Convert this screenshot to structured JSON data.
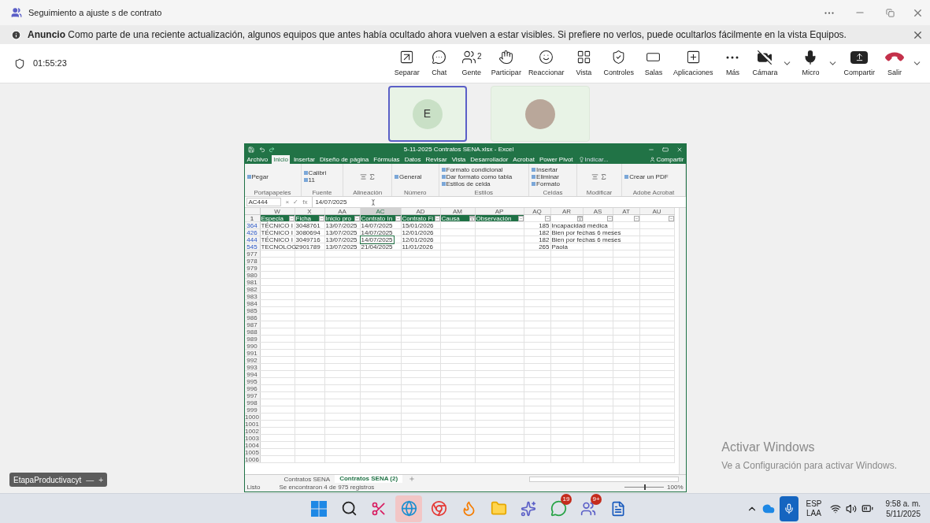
{
  "window": {
    "title": "Seguimiento a ajuste s de contrato"
  },
  "announcement": {
    "label": "Anuncio",
    "text": "Como parte de una reciente actualización, algunos equipos que antes había ocultado ahora vuelven a estar visibles. Si prefiere no verlos, puede ocultarlos fácilmente en la vista Equipos."
  },
  "meeting": {
    "timer": "01:55:23"
  },
  "toolbar": [
    {
      "kind": "popout",
      "label": "Separar"
    },
    {
      "kind": "chat",
      "label": "Chat"
    },
    {
      "kind": "people",
      "label": "Gente",
      "badge": "2"
    },
    {
      "kind": "hand",
      "label": "Participar"
    },
    {
      "kind": "react",
      "label": "Reaccionar"
    },
    {
      "kind": "view",
      "label": "Vista"
    },
    {
      "kind": "controls",
      "label": "Controles"
    },
    {
      "kind": "rooms",
      "label": "Salas"
    },
    {
      "kind": "apps",
      "label": "Aplicaciones"
    },
    {
      "kind": "more",
      "label": "Más"
    },
    {
      "kind": "camera",
      "label": "Cámara",
      "on": false,
      "dropdown": true
    },
    {
      "kind": "mic",
      "label": "Micro",
      "on": true,
      "dropdown": true
    },
    {
      "kind": "share",
      "label": "Compartir"
    },
    {
      "kind": "leave",
      "label": "Salir",
      "dropdown": true
    }
  ],
  "participants": [
    {
      "kind": "initial",
      "initial": "E",
      "speaking": true
    },
    {
      "kind": "photo",
      "speaking": false
    }
  ],
  "excel": {
    "title": "5-11-2025 Contratos SENA.xlsx - Excel",
    "tabs": [
      {
        "label": "Archivo",
        "selected": false
      },
      {
        "label": "Inicio",
        "selected": true
      },
      {
        "label": "Insertar",
        "selected": false
      },
      {
        "label": "Diseño de página",
        "selected": false
      },
      {
        "label": "Fórmulas",
        "selected": false
      },
      {
        "label": "Datos",
        "selected": false
      },
      {
        "label": "Revisar",
        "selected": false
      },
      {
        "label": "Vista",
        "selected": false
      },
      {
        "label": "Desarrollador",
        "selected": false
      },
      {
        "label": "Acrobat",
        "selected": false
      },
      {
        "label": "Power Pivot",
        "selected": false
      }
    ],
    "tell_me": "Indicar...",
    "share": "Compartir",
    "ribbon": [
      {
        "name": "Portapapeles",
        "items": [
          "Pegar"
        ]
      },
      {
        "name": "Fuente",
        "items": [
          "Calibri",
          "11"
        ]
      },
      {
        "name": "Alineación"
      },
      {
        "name": "Número",
        "items": [
          "General"
        ]
      },
      {
        "name": "Estilos",
        "items": [
          "Formato condicional",
          "Dar formato como tabla",
          "Estilos de celda"
        ]
      },
      {
        "name": "Celdas",
        "items": [
          "Insertar",
          "Eliminar",
          "Formato"
        ]
      },
      {
        "name": "Modificar"
      },
      {
        "name": "Adobe Acrobat",
        "items": [
          "Crear un PDF"
        ]
      }
    ],
    "name_box": "AC444",
    "formula_buttons": [
      "×",
      "✓",
      "fx"
    ],
    "formula": "14/07/2025",
    "columns": [
      {
        "label": "W",
        "selected": false
      },
      {
        "label": "X",
        "selected": false
      },
      {
        "label": "AA",
        "selected": false
      },
      {
        "label": "AC",
        "selected": true
      },
      {
        "label": "AD",
        "selected": false
      },
      {
        "label": "AM",
        "selected": false
      },
      {
        "label": "AP",
        "selected": false
      },
      {
        "label": "AQ",
        "selected": false
      },
      {
        "label": "AR",
        "selected": false
      },
      {
        "label": "AS",
        "selected": false
      },
      {
        "label": "AT",
        "selected": false
      },
      {
        "label": "AU",
        "selected": false
      }
    ],
    "header_row": {
      "number": "1",
      "cells": [
        {
          "text": "Especia",
          "filtered": false
        },
        {
          "text": "Ficha",
          "filtered": false
        },
        {
          "text": "Inicio pro",
          "filtered": false
        },
        {
          "text": "Contrato In",
          "filtered": false
        },
        {
          "text": "Contrato Fi",
          "filtered": false
        },
        {
          "text": "Causa",
          "filtered": true
        },
        {
          "text": "Observación",
          "filtered": false
        },
        {
          "filtered": false
        },
        {
          "filtered": true
        },
        {
          "filtered": false
        },
        {
          "filtered": false
        },
        {
          "filtered": false
        }
      ]
    },
    "rows": [
      {
        "number": "364",
        "filtered": true,
        "cells": [
          {
            "text": "TÉCNICO I",
            "selected": false
          },
          {
            "text": "3048761",
            "selected": false
          },
          {
            "text": "13/07/2025",
            "selected": false
          },
          {
            "text": "14/07/2025",
            "selected": false
          },
          {
            "text": "15/01/2026",
            "selected": false
          },
          null,
          null,
          {
            "text": "185",
            "kind": "number",
            "selected": false
          },
          {
            "text": "Incapacidad médica",
            "selected": false
          },
          null,
          null,
          null
        ]
      },
      {
        "number": "426",
        "filtered": true,
        "cells": [
          {
            "text": "TÉCNICO I",
            "selected": false
          },
          {
            "text": "3080694",
            "selected": false
          },
          {
            "text": "13/07/2025",
            "selected": false
          },
          {
            "text": "14/07/2025",
            "selected": false
          },
          {
            "text": "12/01/2026",
            "selected": false
          },
          null,
          null,
          {
            "text": "182",
            "kind": "number",
            "selected": false
          },
          {
            "text": "Bien por fechas 6 meses",
            "selected": false
          },
          null,
          null,
          null
        ]
      },
      {
        "number": "444",
        "filtered": true,
        "cells": [
          {
            "text": "TÉCNICO I",
            "selected": false
          },
          {
            "text": "3049716",
            "selected": false
          },
          {
            "text": "13/07/2025",
            "selected": false
          },
          {
            "text": "14/07/2025",
            "selected": true
          },
          {
            "text": "12/01/2026",
            "selected": false
          },
          null,
          null,
          {
            "text": "182",
            "kind": "number",
            "selected": false
          },
          {
            "text": "Bien por fechas 6 meses",
            "selected": false
          },
          null,
          null,
          null
        ]
      },
      {
        "number": "545",
        "filtered": true,
        "cells": [
          {
            "text": "TECNOLOG",
            "selected": false
          },
          {
            "text": "2901789",
            "selected": false
          },
          {
            "text": "13/07/2025",
            "selected": false
          },
          {
            "text": "21/04/2025",
            "selected": false
          },
          {
            "text": "11/01/2026",
            "selected": false
          },
          null,
          null,
          {
            "text": "265",
            "kind": "number",
            "selected": false
          },
          {
            "text": "Paola",
            "selected": false
          },
          null,
          null,
          null
        ]
      },
      {
        "number": "977",
        "filtered": false
      },
      {
        "number": "978",
        "filtered": false
      },
      {
        "number": "979",
        "filtered": false
      },
      {
        "number": "980",
        "filtered": false
      },
      {
        "number": "981",
        "filtered": false
      },
      {
        "number": "982",
        "filtered": false
      },
      {
        "number": "983",
        "filtered": false
      },
      {
        "number": "984",
        "filtered": false
      },
      {
        "number": "985",
        "filtered": false
      },
      {
        "number": "986",
        "filtered": false
      },
      {
        "number": "987",
        "filtered": false
      },
      {
        "number": "988",
        "filtered": false
      },
      {
        "number": "989",
        "filtered": false
      },
      {
        "number": "990",
        "filtered": false
      },
      {
        "number": "991",
        "filtered": false
      },
      {
        "number": "992",
        "filtered": false
      },
      {
        "number": "993",
        "filtered": false
      },
      {
        "number": "994",
        "filtered": false
      },
      {
        "number": "995",
        "filtered": false
      },
      {
        "number": "996",
        "filtered": false
      },
      {
        "number": "997",
        "filtered": false
      },
      {
        "number": "998",
        "filtered": false
      },
      {
        "number": "999",
        "filtered": false
      },
      {
        "number": "1000",
        "filtered": false
      },
      {
        "number": "1001",
        "filtered": false
      },
      {
        "number": "1002",
        "filtered": false
      },
      {
        "number": "1003",
        "filtered": false
      },
      {
        "number": "1004",
        "filtered": false
      },
      {
        "number": "1005",
        "filtered": false
      },
      {
        "number": "1006",
        "filtered": false
      }
    ],
    "sheets": [
      {
        "label": "Contratos SENA",
        "selected": false
      },
      {
        "label": "Contratos SENA (2)",
        "selected": true
      }
    ],
    "status": {
      "ready": "Listo",
      "message": "Se encontraron 4 de 975 registros",
      "zoom_slider": {
        "level": 0.5
      },
      "zoom": "100%"
    }
  },
  "tag": {
    "label": "EtapaProductivacyt",
    "buttons": [
      "—",
      "+"
    ]
  },
  "activation": {
    "title": "Activar Windows",
    "text": "Ve a Configuración para activar Windows."
  },
  "taskbar": {
    "apps": [
      {
        "kind": "start",
        "selected": false
      },
      {
        "kind": "search",
        "selected": false
      },
      {
        "kind": "snip",
        "selected": false
      },
      {
        "kind": "edge",
        "selected": true
      },
      {
        "kind": "chrome",
        "selected": false
      },
      {
        "kind": "firefox",
        "selected": false
      },
      {
        "kind": "explorer",
        "selected": false
      },
      {
        "kind": "copilot",
        "selected": false
      },
      {
        "kind": "whatsapp",
        "selected": false,
        "badge": "19"
      },
      {
        "kind": "teams",
        "selected": false,
        "badge": "9+"
      },
      {
        "kind": "word",
        "selected": false
      }
    ],
    "language": [
      "ESP",
      "LAA"
    ],
    "time": "9:58 a. m.",
    "date": "5/11/2025"
  }
}
